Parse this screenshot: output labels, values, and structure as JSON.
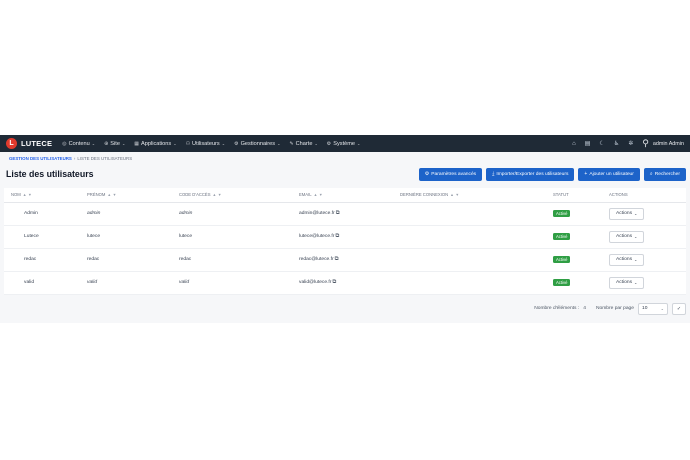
{
  "navbar": {
    "brand": "LUTECE",
    "brand_letter": "L",
    "menu": [
      {
        "icon": "◎",
        "label": "Contenu"
      },
      {
        "icon": "⊕",
        "label": "Site"
      },
      {
        "icon": "▦",
        "label": "Applications"
      },
      {
        "icon": "⚇",
        "label": "Utilisateurs"
      },
      {
        "icon": "⚙",
        "label": "Gestionnaires"
      },
      {
        "icon": "✎",
        "label": "Charte"
      },
      {
        "icon": "⚙",
        "label": "Système"
      }
    ],
    "user": "admin Admin"
  },
  "breadcrumb": {
    "parent": "Gestion des utilisateurs",
    "separator": "›",
    "current": "Liste des utilisateurs"
  },
  "page": {
    "title": "Liste des utilisateurs"
  },
  "toolbar": {
    "advanced": "Paramètres avancés",
    "import_export": "Importer/Exporter des utilisateurs",
    "add": "Ajouter un utilisateur",
    "search": "Rechercher"
  },
  "table": {
    "columns": {
      "nom": "Nom",
      "prenom": "Prénom",
      "code": "Code d'accès",
      "email": "Email",
      "last_login": "Dernière connexion",
      "status": "Statut",
      "actions": "Actions"
    },
    "rows": [
      {
        "nom": "Admin",
        "prenom": "admin",
        "code": "admin",
        "email": "admin@lutece.fr",
        "last_login": "",
        "status": "Activé",
        "actions": "Actions"
      },
      {
        "nom": "Lutece",
        "prenom": "lutece",
        "code": "lutece",
        "email": "lutece@lutece.fr",
        "last_login": "",
        "status": "Activé",
        "actions": "Actions"
      },
      {
        "nom": "redac",
        "prenom": "redac",
        "code": "redac",
        "email": "redac@lutece.fr",
        "last_login": "",
        "status": "Activé",
        "actions": "Actions"
      },
      {
        "nom": "valid",
        "prenom": "valid",
        "code": "valid",
        "email": "valid@lutece.fr",
        "last_login": "",
        "status": "Activé",
        "actions": "Actions"
      }
    ]
  },
  "pager": {
    "count_label": "Nombre d'éléments :",
    "count": "4",
    "per_page_label": "Nombre par page",
    "per_page_value": "10"
  },
  "colors": {
    "navbar": "#1f2a36",
    "primary": "#1d63c9",
    "success": "#2f9e44",
    "brand_red": "#e03a2d"
  }
}
